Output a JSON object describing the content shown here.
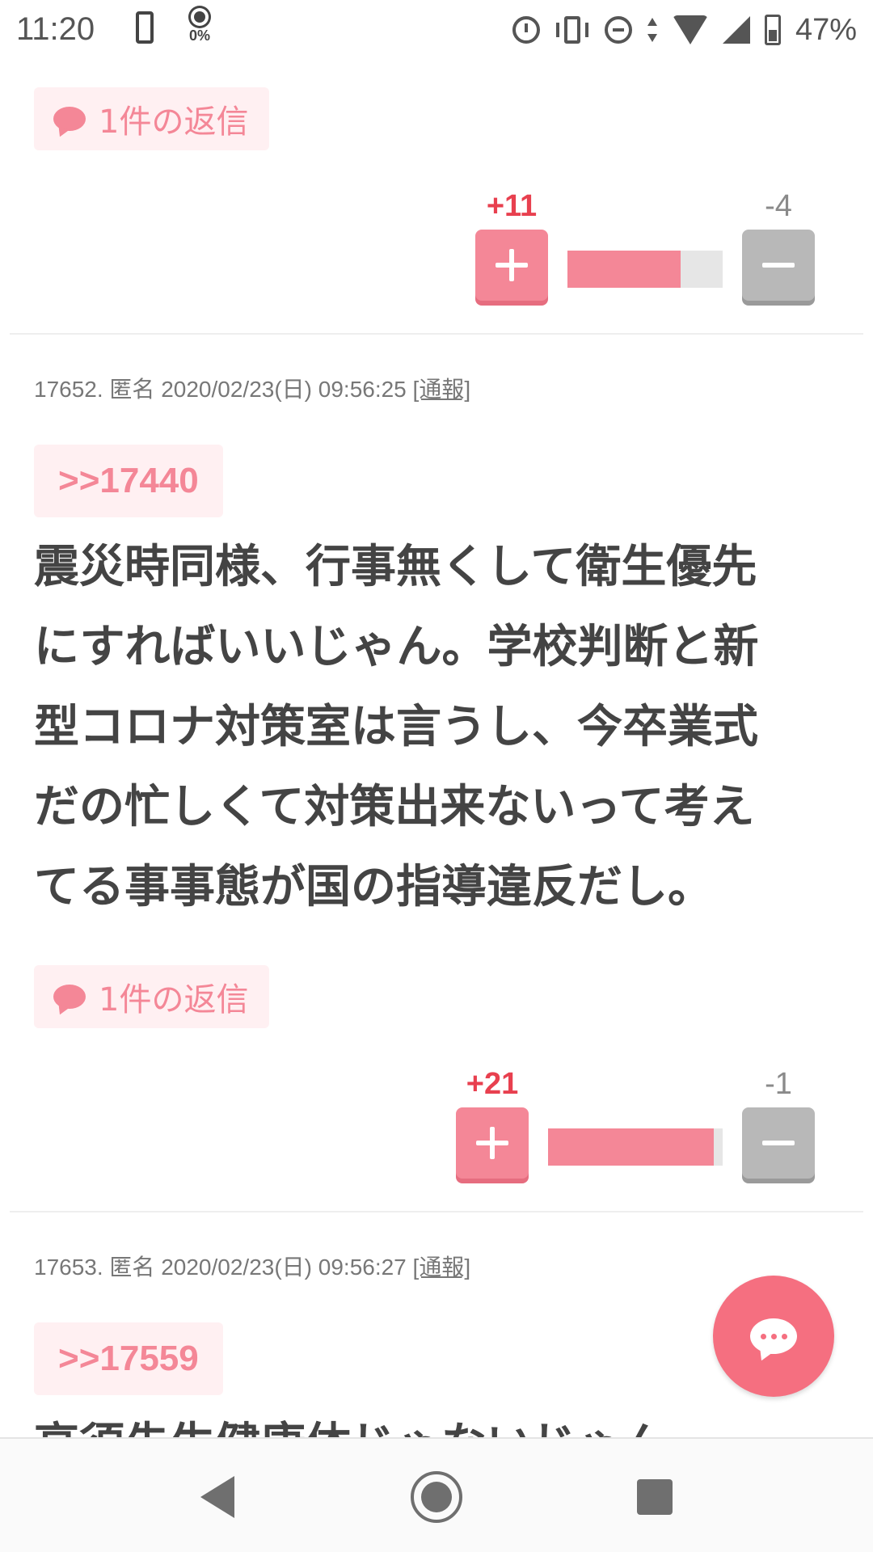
{
  "status_bar": {
    "time": "11:20",
    "brightness_pct": "0%",
    "battery_pct": "47%",
    "icons": [
      "phone-icon",
      "brightness-icon",
      "alarm-icon",
      "vibrate-icon",
      "dnd-icon",
      "data-arrows-icon",
      "wifi-icon",
      "cell-signal-icon",
      "battery-charging-icon"
    ]
  },
  "colors": {
    "accent": "#f48797",
    "accent_dark": "#e8404f",
    "badge_bg": "#fff0f2",
    "minus_btn": "#b8b8b8",
    "fab": "#f56f80"
  },
  "posts": [
    {
      "replies_label": "1件の返信",
      "votes": {
        "plus": "+11",
        "minus": "-4",
        "plus_ratio": 0.73
      }
    },
    {
      "meta": "17652. 匿名 2020/02/23(日) 09:56:25",
      "report_label": "[通報]",
      "anchor": ">>17440",
      "body_lines": [
        "震災時同様、行事無くして衛生優先",
        "にすればいいじゃん。学校判断と新",
        "型コロナ対策室は言うし、今卒業式",
        "だの忙しくて対策出来ないって考え",
        "てる事事態が国の指導違反だし。"
      ],
      "replies_label": "1件の返信",
      "votes": {
        "plus": "+21",
        "minus": "-1",
        "plus_ratio": 0.95
      }
    },
    {
      "meta": "17653. 匿名 2020/02/23(日) 09:56:27",
      "report_label": "[通報]",
      "anchor": ">>17559",
      "body_lines": [
        "高須先生健康体じゃないじゃん"
      ]
    }
  ],
  "fab": {
    "icon": "chat-bubble-icon"
  },
  "nav_bar": {
    "icons": [
      "back-icon",
      "home-icon",
      "recents-icon"
    ]
  }
}
